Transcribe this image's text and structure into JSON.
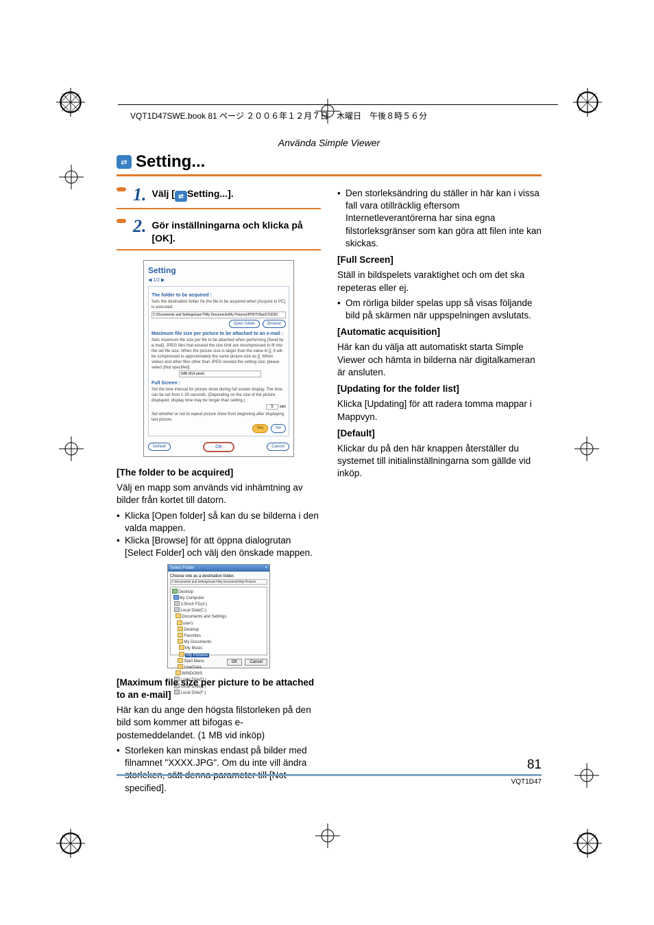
{
  "header": {
    "line": "VQT1D47SWE.book  81 ページ  ２００６年１２月７日　木曜日　午後８時５６分"
  },
  "section_header": "Använda Simple Viewer",
  "title": "Setting...",
  "steps": {
    "s1_prefix": "Välj [",
    "s1_suffix": "Setting...].",
    "s2": "Gör inställningarna och klicka på [OK]."
  },
  "screenshot1": {
    "title": "Setting",
    "nav_prev": "◀",
    "nav_page": "1/2",
    "nav_next": "▶",
    "folder_label": "The folder to be acquired :",
    "folder_desc": "Sets the destination folder for the file to be acquired when [Acquire to PC] is executed.",
    "folder_path": "C:\\Documents and Settings\\userT\\My Documents\\My Pictures\\PHOTOfunSTUDIO",
    "open_folder": "Open folder",
    "browse": "Browse",
    "max_label": "Maximum file size per picture to be attached to an e-mail :",
    "max_desc": "Sets maximum file size per file to be attached when performing [Send by e-mail]. JPEG files that exceed the size limit are recompressed to fit into the set file size. When the picture size is larger than the value in [], it will be compressed to approximately the same picture size as []. When videos and other files other than JPEG exceed the setting size, please select [Not specified].",
    "max_value": "1MB (814 pixel)",
    "full_label": "Full Screen :",
    "full_desc": "Set the time interval for picture show during full screen display. The time can be set from 1-30 seconds. (Depending on the size of the picture displayed, display time may be longer than setting.)",
    "full_val": "5",
    "full_unit": "sec",
    "repeat_desc": "Set whether or not to repeat picture show from beginning after displaying last picture.",
    "yes": "Yes",
    "no": "No",
    "default": "Default",
    "ok": "OK",
    "cancel": "Cancel"
  },
  "screenshot2": {
    "title": "Select Folder",
    "close": "×",
    "desc": "Choose one as a destination folder.",
    "path": "C:\\Documents and Settings\\userT\\My Documents\\My Pictures",
    "ok": "OK",
    "cancel": "Cancel",
    "tree": {
      "l1": "Desktop",
      "l2": "My Computer",
      "l3": "3.5Inch FD(A:)",
      "l4": "Local Disk(C:)",
      "l5": "Documents and Settings",
      "l6": "user1",
      "l7": "Desktop",
      "l8": "Favorites",
      "l9": "My Documents",
      "l10": "My Music",
      "l11": "My Pictures",
      "l12": "Start Menu",
      "l13": "UserData",
      "l14": "WINDOWS",
      "l15": "Local Disk(D:)",
      "l16": "Local Disk(E:)",
      "l17": "Local Disk(F:)"
    }
  },
  "left": {
    "h1": "[The folder to be acquired]",
    "p1": "Välj en mapp som används vid inhämtning av bilder från kortet till datorn.",
    "b1": "Klicka [Open folder] så kan du se bilderna i den valda mappen.",
    "b2": "Klicka [Browse] för att öppna dialogrutan [Select Folder] och välj den önskade mappen.",
    "h2": "[Maximum file size per picture to be attached to an e-mail]",
    "p2": "Här kan du ange den högsta filstorleken på den bild som kommer att bifogas e-postemeddelandet. (1 MB vid inköp)",
    "b3": "Storleken kan minskas endast på bilder med filnamnet \"XXXX.JPG\". Om du inte vill ändra storleken, sätt denna parameter till [Not specified]."
  },
  "right": {
    "b1": "Den storleksändring du ställer in här kan i vissa fall vara otillräcklig eftersom Internetleverantörerna har sina egna filstorleksgränser som kan göra att filen inte kan skickas.",
    "h1": "[Full Screen]",
    "p1": "Ställ in bildspelets varaktighet och om det ska repeteras eller ej.",
    "b2": "Om rörliga bilder spelas upp så visas följande bild på skärmen när uppspelningen avslutats.",
    "h2": "[Automatic acquisition]",
    "p2": "Här kan du välja att automatiskt starta Simple Viewer och hämta in bilderna när digitalkameran är ansluten.",
    "h3": "[Updating for the folder list]",
    "p3": "Klicka [Updating] för att radera tomma mappar i Mappvyn.",
    "h4": "[Default]",
    "p4": "Klickar du på den här knappen återställer du systemet till initialinställningarna som gällde vid inköp."
  },
  "footer": {
    "page": "81",
    "docid": "VQT1D47"
  }
}
